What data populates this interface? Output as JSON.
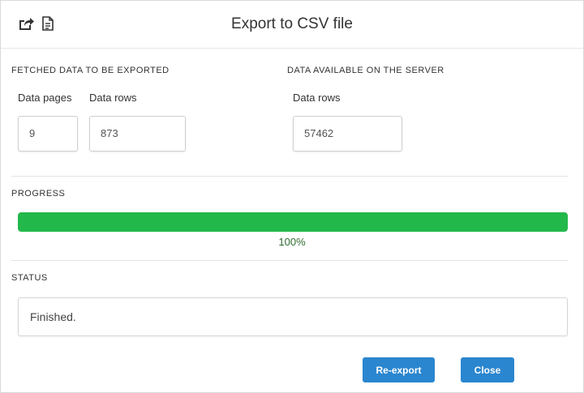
{
  "dialog": {
    "title": "Export to CSV file",
    "icons": [
      "share-export-icon",
      "document-icon"
    ]
  },
  "fetched": {
    "heading": "FETCHED DATA TO BE EXPORTED",
    "pages_label": "Data pages",
    "pages_value": "9",
    "rows_label": "Data rows",
    "rows_value": "873"
  },
  "server": {
    "heading": "DATA AVAILABLE ON THE SERVER",
    "rows_label": "Data rows",
    "rows_value": "57462"
  },
  "progress": {
    "heading": "PROGRESS",
    "value": 1.0,
    "text": "100%",
    "color": "#22b84a"
  },
  "status": {
    "heading": "STATUS",
    "text": "Finished."
  },
  "actions": {
    "reexport_label": "Re-export",
    "close_label": "Close",
    "color": "#2a86cf"
  }
}
